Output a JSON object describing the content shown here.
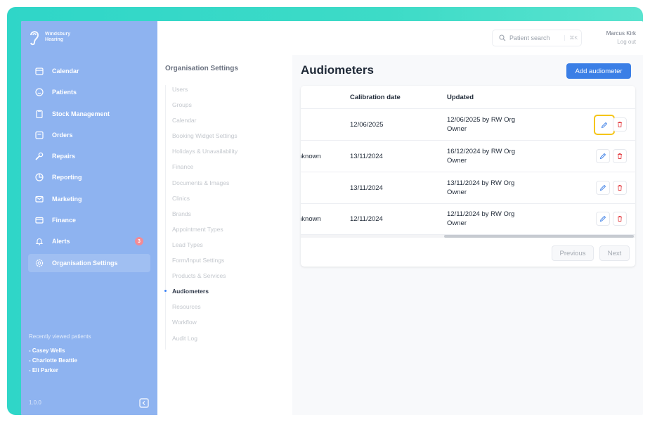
{
  "brand": {
    "line1": "Windsbury",
    "line2": "Hearing"
  },
  "sidebar": {
    "items": [
      {
        "label": "Calendar",
        "icon": "calendar-icon"
      },
      {
        "label": "Patients",
        "icon": "smile-icon"
      },
      {
        "label": "Stock Management",
        "icon": "clipboard-icon"
      },
      {
        "label": "Orders",
        "icon": "orders-icon"
      },
      {
        "label": "Repairs",
        "icon": "wrench-icon"
      },
      {
        "label": "Reporting",
        "icon": "chart-pie-icon"
      },
      {
        "label": "Marketing",
        "icon": "envelope-icon"
      },
      {
        "label": "Finance",
        "icon": "credit-card-icon"
      },
      {
        "label": "Alerts",
        "icon": "bell-icon",
        "badge": "3"
      },
      {
        "label": "Organisation Settings",
        "icon": "gear-icon",
        "active": true
      }
    ],
    "recent_title": "Recently viewed patients",
    "recent": [
      "- Casey Wells",
      "- Charlotte Beattie",
      "- Eli Parker"
    ],
    "version": "1.0.0"
  },
  "topbar": {
    "search_label": "Patient search",
    "search_shortcut": "⌘K",
    "user_name": "Marcus Kirk",
    "logout": "Log out"
  },
  "subnav": {
    "title": "Organisation Settings",
    "items": [
      "Users",
      "Groups",
      "Calendar",
      "Booking Widget Settings",
      "Holidays & Unavailability",
      "Finance",
      "Documents & Images",
      "Clinics",
      "Brands",
      "Appointment Types",
      "Lead Types",
      "Form/Input Settings",
      "Products & Services",
      "Audiometers",
      "Resources",
      "Workflow",
      "Audit Log"
    ],
    "active_index": 13
  },
  "main": {
    "title": "Audiometers",
    "add_button": "Add audiometer",
    "columns": {
      "calibration": "Calibration date",
      "updated": "Updated"
    },
    "rows": [
      {
        "status": "",
        "calibration": "12/06/2025",
        "updated_line1": "12/06/2025 by RW Org",
        "updated_line2": "Owner"
      },
      {
        "status": "nknown",
        "calibration": "13/11/2024",
        "updated_line1": "16/12/2024 by RW Org",
        "updated_line2": "Owner"
      },
      {
        "status": "",
        "calibration": "13/11/2024",
        "updated_line1": "13/11/2024 by RW Org",
        "updated_line2": "Owner"
      },
      {
        "status": "nknown",
        "calibration": "12/11/2024",
        "updated_line1": "12/11/2024 by RW Org",
        "updated_line2": "Owner"
      }
    ],
    "pager": {
      "previous": "Previous",
      "next": "Next"
    }
  },
  "colors": {
    "frame": "#3ddbc7",
    "sidebar": "#8eb3f0",
    "primary": "#3b7fe6",
    "danger": "#e5484d",
    "focus_ring": "#f5c518"
  }
}
